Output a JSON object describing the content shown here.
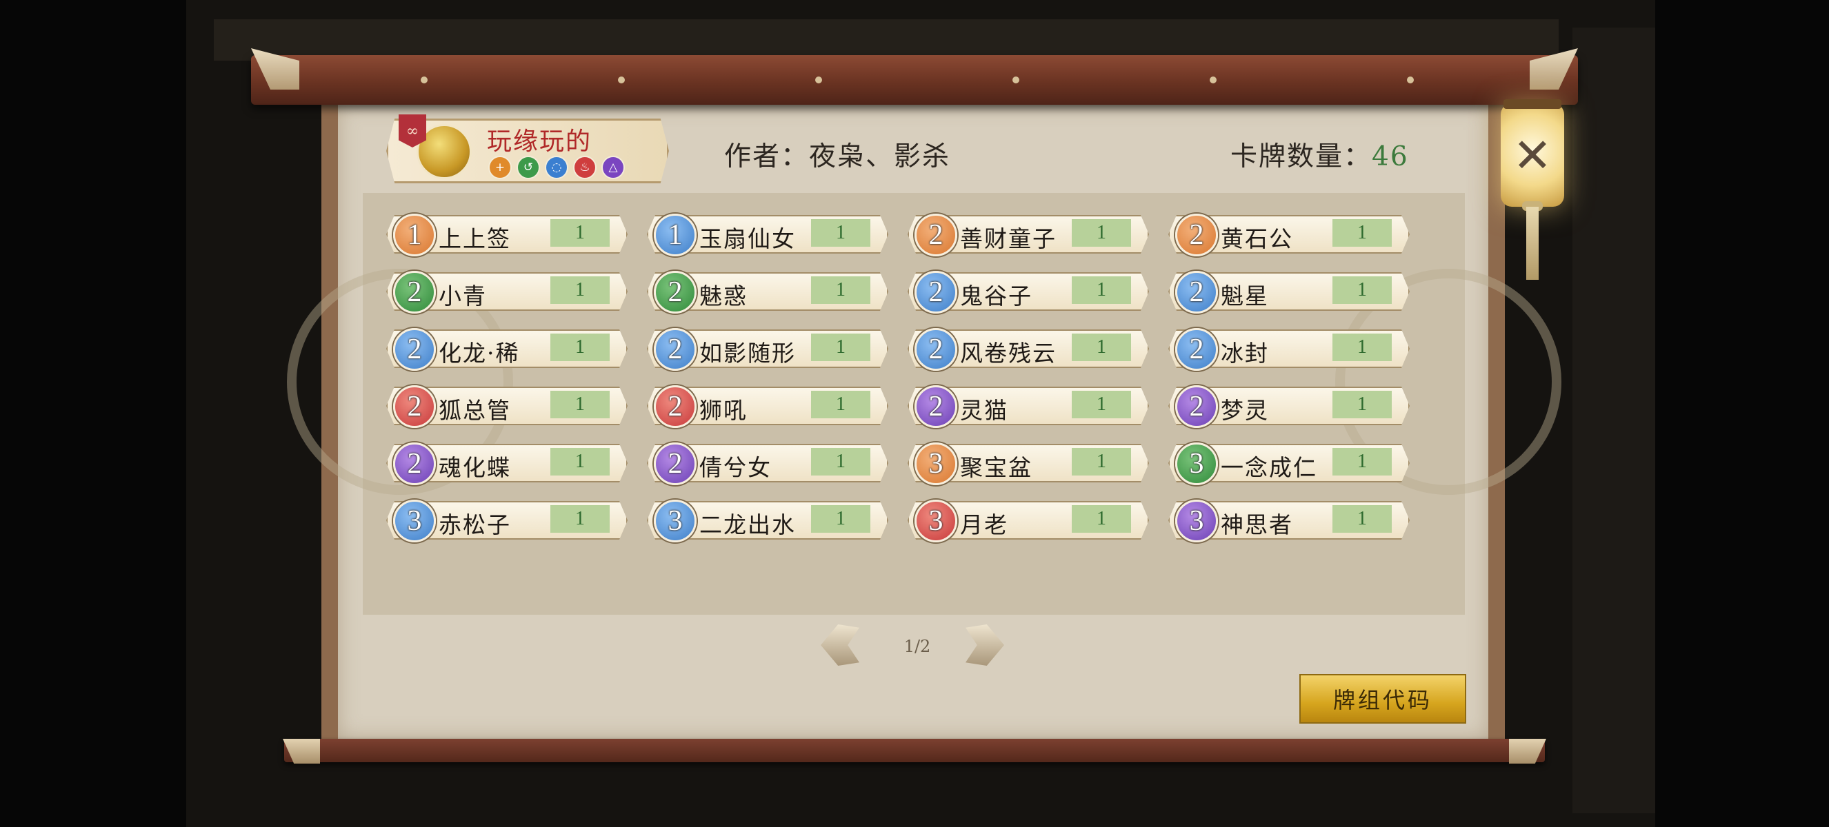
{
  "deck": {
    "name": "玩缘玩的",
    "elements": [
      {
        "icon": "plus-element-icon",
        "glyph": "+",
        "color": "#e08a2a"
      },
      {
        "icon": "wind-element-icon",
        "glyph": "↺",
        "color": "#3d9a4a"
      },
      {
        "icon": "water-element-icon",
        "glyph": "◌",
        "color": "#3b7fd0"
      },
      {
        "icon": "fire-element-icon",
        "glyph": "♨",
        "color": "#cf3e3e"
      },
      {
        "icon": "mountain-element-icon",
        "glyph": "△",
        "color": "#7a45c0"
      }
    ]
  },
  "author_label": "作者：夜枭、影杀",
  "card_count": {
    "label": "卡牌数量：",
    "value": "46"
  },
  "cards": [
    {
      "cost": "1",
      "color": "orange",
      "name": "上上签",
      "count": "1"
    },
    {
      "cost": "1",
      "color": "blue",
      "name": "玉扇仙女",
      "count": "1"
    },
    {
      "cost": "2",
      "color": "orange",
      "name": "善财童子",
      "count": "1"
    },
    {
      "cost": "2",
      "color": "orange",
      "name": "黄石公",
      "count": "1"
    },
    {
      "cost": "2",
      "color": "green",
      "name": "小青",
      "count": "1"
    },
    {
      "cost": "2",
      "color": "green",
      "name": "魅惑",
      "count": "1"
    },
    {
      "cost": "2",
      "color": "blue",
      "name": "鬼谷子",
      "count": "1"
    },
    {
      "cost": "2",
      "color": "blue",
      "name": "魁星",
      "count": "1"
    },
    {
      "cost": "2",
      "color": "blue",
      "name": "化龙·稀",
      "count": "1"
    },
    {
      "cost": "2",
      "color": "blue",
      "name": "如影随形",
      "count": "1"
    },
    {
      "cost": "2",
      "color": "blue",
      "name": "风卷残云",
      "count": "1"
    },
    {
      "cost": "2",
      "color": "blue",
      "name": "冰封",
      "count": "1"
    },
    {
      "cost": "2",
      "color": "red",
      "name": "狐总管",
      "count": "1"
    },
    {
      "cost": "2",
      "color": "red",
      "name": "狮吼",
      "count": "1"
    },
    {
      "cost": "2",
      "color": "purple",
      "name": "灵猫",
      "count": "1"
    },
    {
      "cost": "2",
      "color": "purple",
      "name": "梦灵",
      "count": "1"
    },
    {
      "cost": "2",
      "color": "purple",
      "name": "魂化蝶",
      "count": "1"
    },
    {
      "cost": "2",
      "color": "purple",
      "name": "倩兮女",
      "count": "1"
    },
    {
      "cost": "3",
      "color": "orange",
      "name": "聚宝盆",
      "count": "1"
    },
    {
      "cost": "3",
      "color": "green",
      "name": "一念成仁",
      "count": "1"
    },
    {
      "cost": "3",
      "color": "blue",
      "name": "赤松子",
      "count": "1"
    },
    {
      "cost": "3",
      "color": "blue",
      "name": "二龙出水",
      "count": "1"
    },
    {
      "cost": "3",
      "color": "red",
      "name": "月老",
      "count": "1"
    },
    {
      "cost": "3",
      "color": "purple",
      "name": "神思者",
      "count": "1"
    }
  ],
  "pagination": {
    "label": "1/2",
    "current": 1,
    "total": 2
  },
  "deck_code_button": "牌组代码",
  "close_icon": "close-icon",
  "colors": {
    "count_text": "#3c7a3c",
    "deck_name": "#b02828",
    "button_gold": "#d6a51e"
  }
}
